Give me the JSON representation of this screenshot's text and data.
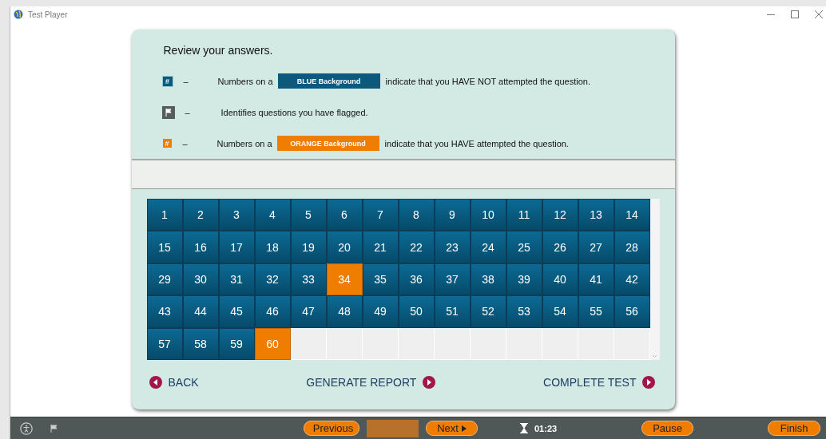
{
  "window": {
    "title": "Test Player"
  },
  "legend": {
    "heading": "Review your answers.",
    "items": [
      {
        "kind": "unattempted",
        "symbol": "#",
        "dash": "–",
        "prefix": "Numbers on a",
        "swatch": "BLUE Background",
        "suffix": "indicate that you HAVE NOT attempted the question."
      },
      {
        "kind": "flagged",
        "dash": "–",
        "text": "Identifies questions you have flagged."
      },
      {
        "kind": "attempted",
        "symbol": "#",
        "dash": "–",
        "prefix": "Numbers on a",
        "swatch": "ORANGE Background",
        "suffix": "indicate that you HAVE attempted the question."
      }
    ]
  },
  "questions": [
    {
      "number": "1",
      "attempted": false
    },
    {
      "number": "2",
      "attempted": false
    },
    {
      "number": "3",
      "attempted": false
    },
    {
      "number": "4",
      "attempted": false
    },
    {
      "number": "5",
      "attempted": false
    },
    {
      "number": "6",
      "attempted": false
    },
    {
      "number": "7",
      "attempted": false
    },
    {
      "number": "8",
      "attempted": false
    },
    {
      "number": "9",
      "attempted": false
    },
    {
      "number": "10",
      "attempted": false
    },
    {
      "number": "11",
      "attempted": false
    },
    {
      "number": "12",
      "attempted": false
    },
    {
      "number": "13",
      "attempted": false
    },
    {
      "number": "14",
      "attempted": false
    },
    {
      "number": "15",
      "attempted": false
    },
    {
      "number": "16",
      "attempted": false
    },
    {
      "number": "17",
      "attempted": false
    },
    {
      "number": "18",
      "attempted": false
    },
    {
      "number": "19",
      "attempted": false
    },
    {
      "number": "20",
      "attempted": false
    },
    {
      "number": "21",
      "attempted": false
    },
    {
      "number": "22",
      "attempted": false
    },
    {
      "number": "23",
      "attempted": false
    },
    {
      "number": "24",
      "attempted": false
    },
    {
      "number": "25",
      "attempted": false
    },
    {
      "number": "26",
      "attempted": false
    },
    {
      "number": "27",
      "attempted": false
    },
    {
      "number": "28",
      "attempted": false
    },
    {
      "number": "29",
      "attempted": false
    },
    {
      "number": "30",
      "attempted": false
    },
    {
      "number": "31",
      "attempted": false
    },
    {
      "number": "32",
      "attempted": false
    },
    {
      "number": "33",
      "attempted": false
    },
    {
      "number": "34",
      "attempted": true
    },
    {
      "number": "35",
      "attempted": false
    },
    {
      "number": "36",
      "attempted": false
    },
    {
      "number": "37",
      "attempted": false
    },
    {
      "number": "38",
      "attempted": false
    },
    {
      "number": "39",
      "attempted": false
    },
    {
      "number": "40",
      "attempted": false
    },
    {
      "number": "41",
      "attempted": false
    },
    {
      "number": "42",
      "attempted": false
    },
    {
      "number": "43",
      "attempted": false
    },
    {
      "number": "44",
      "attempted": false
    },
    {
      "number": "45",
      "attempted": false
    },
    {
      "number": "46",
      "attempted": false
    },
    {
      "number": "47",
      "attempted": false
    },
    {
      "number": "48",
      "attempted": false
    },
    {
      "number": "49",
      "attempted": false
    },
    {
      "number": "50",
      "attempted": false
    },
    {
      "number": "51",
      "attempted": false
    },
    {
      "number": "52",
      "attempted": false
    },
    {
      "number": "53",
      "attempted": false
    },
    {
      "number": "54",
      "attempted": false
    },
    {
      "number": "55",
      "attempted": false
    },
    {
      "number": "56",
      "attempted": false
    },
    {
      "number": "57",
      "attempted": false
    },
    {
      "number": "58",
      "attempted": false
    },
    {
      "number": "59",
      "attempted": false
    },
    {
      "number": "60",
      "attempted": true
    }
  ],
  "actions": [
    {
      "label": "BACK",
      "kind": "back"
    },
    {
      "label": "GENERATE REPORT",
      "kind": "forward"
    },
    {
      "label": "COMPLETE TEST",
      "kind": "forward"
    }
  ],
  "toolbar": {
    "previous": "Previous",
    "next": "Next",
    "timer": "01:23",
    "pause": "Pause",
    "finish": "Finish"
  }
}
